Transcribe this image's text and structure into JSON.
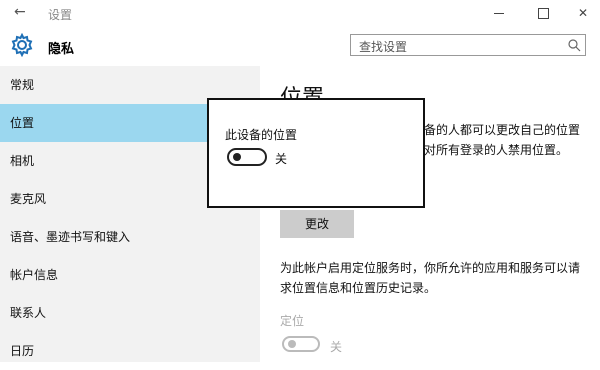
{
  "window": {
    "title": "设置",
    "back_glyph": "←",
    "close_glyph": "✕"
  },
  "header": {
    "title": "隐私",
    "search_placeholder": "查找设置"
  },
  "sidebar": {
    "items": [
      {
        "label": "常规",
        "active": false
      },
      {
        "label": "位置",
        "active": true
      },
      {
        "label": "相机",
        "active": false
      },
      {
        "label": "麦克风",
        "active": false
      },
      {
        "label": "语音、墨迹书写和键入",
        "active": false
      },
      {
        "label": "帐户信息",
        "active": false
      },
      {
        "label": "联系人",
        "active": false
      },
      {
        "label": "日历",
        "active": false
      }
    ]
  },
  "main": {
    "title": "位置",
    "description": "如果已启用，登录到这台设备的人都可以更改自己的位置设置。如果禁用此设置，则对所有登录的人禁用位置。",
    "change_button": "更改",
    "description2": "为此帐户启用定位服务时，你所允许的应用和服务可以请求位置信息和位置历史记录。",
    "location_label": "定位",
    "location_toggle_label": "关",
    "location_toggle_on": false
  },
  "popup": {
    "title": "此设备的位置",
    "toggle_label": "关",
    "toggle_on": false
  },
  "colors": {
    "sidebar_bg": "#f2f2f2",
    "active_item_bg": "#9bd7ef",
    "accent": "#0078d7",
    "button_bg": "#cccccc"
  },
  "icons": {
    "header": "gear-icon",
    "search": "search-icon",
    "back": "back-arrow-icon"
  }
}
